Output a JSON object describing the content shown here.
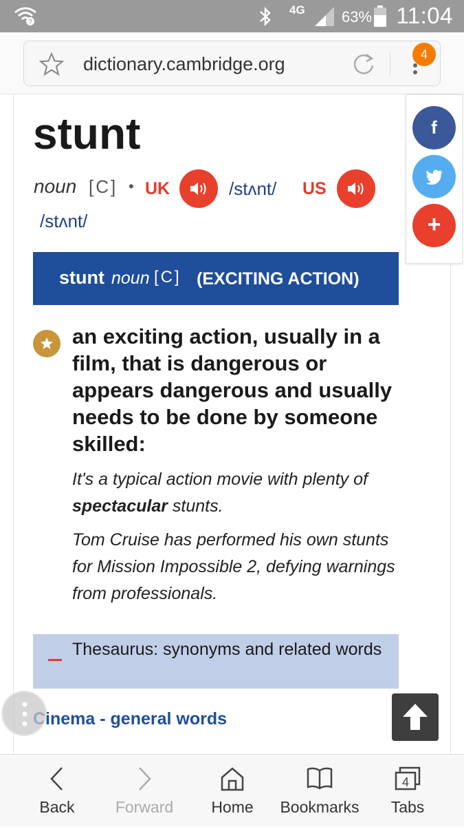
{
  "status_bar": {
    "network": "4G",
    "battery": "63%",
    "time": "11:04",
    "icons": [
      "wifi-icon",
      "bluetooth-icon",
      "signal-icon",
      "battery-icon"
    ]
  },
  "browser": {
    "url": "dictionary.cambridge.org",
    "tab_count": "4"
  },
  "entry": {
    "headword": "stunt",
    "pos": "noun",
    "grammar": "[C]",
    "bullet": "•",
    "uk_label": "UK",
    "uk_ipa": "/stʌnt/",
    "us_label": "US",
    "us_ipa": "/stʌnt/",
    "sense": {
      "headword": "stunt",
      "pos": "noun",
      "grammar": "[C]",
      "guideword": "(EXCITING ACTION)"
    },
    "definition": "an exciting action, usually in a film, that is dangerous or appears dangerous and usually needs to be done by someone skilled:",
    "examples": [
      {
        "before": "It's a typical action movie with plenty of ",
        "bold": "spectacular",
        "after": " stunts."
      },
      {
        "before": "Tom Cruise has performed his own stunts for Mission Impossible 2, defying warnings from professionals.",
        "bold": "",
        "after": ""
      }
    ],
    "thesaurus_label": "Thesaurus: synonyms and related words",
    "topic_link": "Cinema - general words"
  },
  "share": {
    "facebook": "f",
    "plus": "+"
  },
  "bottom_nav": {
    "back": "Back",
    "forward": "Forward",
    "home": "Home",
    "bookmarks": "Bookmarks",
    "tabs": "Tabs",
    "tabs_count": "4"
  },
  "colors": {
    "accent_red": "#e8402c",
    "sense_blue": "#1f4e9b",
    "thesaurus_bg": "#c0cee8",
    "facebook": "#3b5998",
    "twitter": "#55acee",
    "badge_orange": "#f57c00"
  }
}
